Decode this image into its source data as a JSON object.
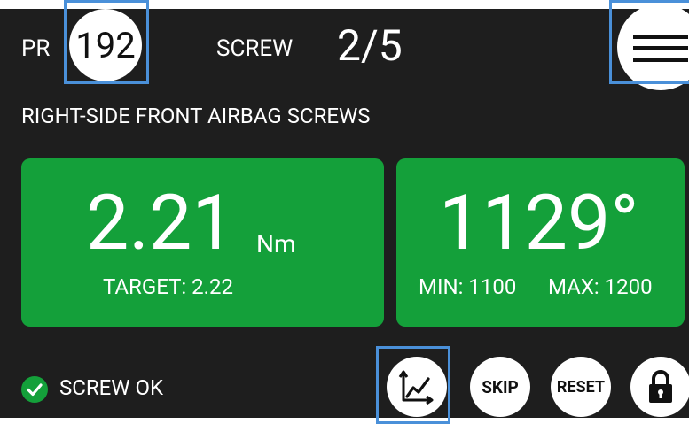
{
  "header": {
    "pr_label": "PR",
    "pr_value": "192",
    "screw_label": "SCREW",
    "screw_count": "2/5"
  },
  "subtitle": "RIGHT-SIDE FRONT AIRBAG SCREWS",
  "torque": {
    "value": "2.21",
    "unit": "Nm",
    "target_text": "TARGET: 2.22"
  },
  "angle": {
    "value": "1129°",
    "min_text": "MIN: 1100",
    "max_text": "MAX: 1200"
  },
  "status": {
    "text": "SCREW OK"
  },
  "actions": {
    "skip_label": "SKIP",
    "reset_label": "RESET"
  },
  "colors": {
    "background": "#1e1e1e",
    "panel_green": "#14a03a",
    "highlight_blue": "#4a90d9"
  },
  "icons": [
    "menu-icon",
    "chart-icon",
    "lock-icon",
    "check-icon"
  ]
}
